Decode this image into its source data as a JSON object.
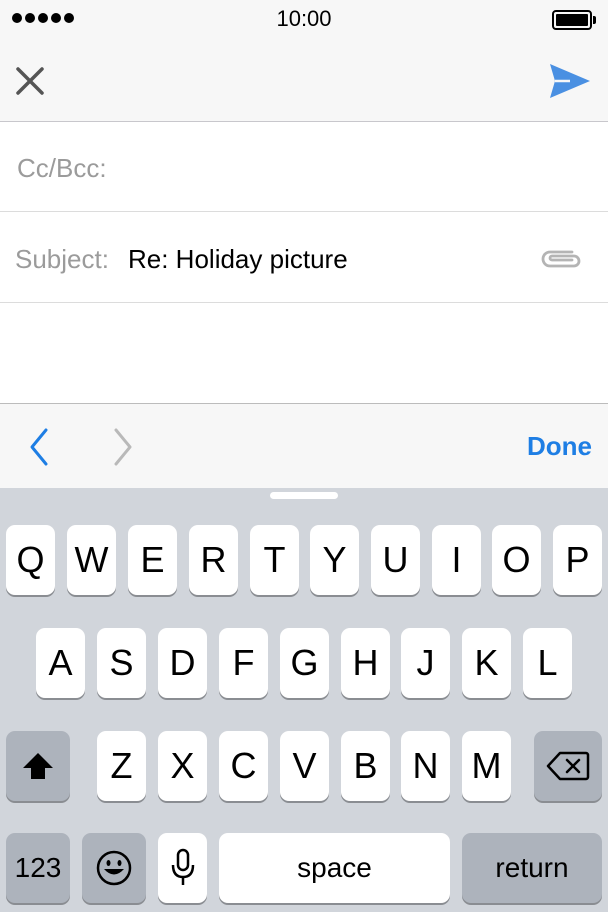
{
  "status_bar": {
    "signal_dots": 5,
    "time": "10:00",
    "battery_level": 1.0
  },
  "nav_bar": {
    "close_icon": "close-icon",
    "send_icon": "send-icon",
    "accent_color": "#4a90e2"
  },
  "compose": {
    "cc_bcc_label": "Cc/Bcc:",
    "cc_bcc_value": "",
    "subject_label": "Subject:",
    "subject_value": "Re: Holiday picture",
    "attachment_icon": "paperclip-icon"
  },
  "accessory_bar": {
    "prev_icon": "chevron-left-icon",
    "next_icon": "chevron-right-icon",
    "done_label": "Done",
    "done_color": "#1e7ee4"
  },
  "keyboard": {
    "row1": [
      "Q",
      "W",
      "E",
      "R",
      "T",
      "Y",
      "U",
      "I",
      "O",
      "P"
    ],
    "row2": [
      "A",
      "S",
      "D",
      "F",
      "G",
      "H",
      "J",
      "K",
      "L"
    ],
    "row3": [
      "Z",
      "X",
      "C",
      "V",
      "B",
      "N",
      "M"
    ],
    "shift_icon": "shift-icon",
    "delete_icon": "delete-icon",
    "numbers_label": "123",
    "emoji_icon": "emoji-icon",
    "mic_icon": "microphone-icon",
    "space_label": "space",
    "return_label": "return"
  }
}
